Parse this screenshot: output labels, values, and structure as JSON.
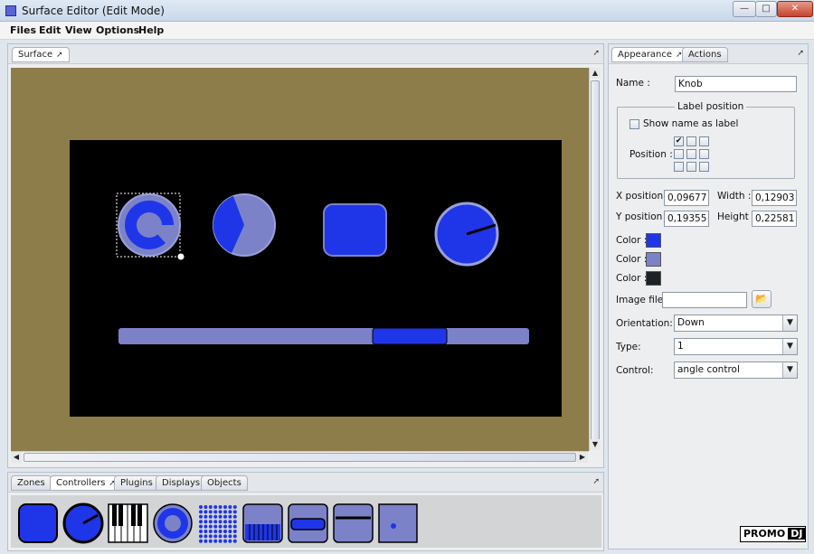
{
  "window": {
    "title": "Surface Editor (Edit Mode)"
  },
  "menu": [
    "Files",
    "Edit",
    "View",
    "Options",
    "Help"
  ],
  "surface_panel": {
    "tab_label": "Surface"
  },
  "bottom_panel": {
    "tabs": [
      "Zones",
      "Controllers",
      "Plugins",
      "Displays",
      "Objects"
    ],
    "active_tab": "Controllers"
  },
  "right_panel": {
    "tabs": [
      "Appearance",
      "Actions"
    ],
    "active_tab": "Appearance",
    "name_label": "Name :",
    "name_value": "Knob",
    "label_position": {
      "title": "Label position",
      "show_name_label": "Show name as label",
      "show_name_checked": false,
      "position_label": "Position :",
      "grid_checked": [
        true,
        false,
        false,
        false,
        false,
        false,
        false,
        false,
        false
      ]
    },
    "x_position_label": "X position :",
    "x_position_value": "0,09677",
    "width_label": "Width :",
    "width_value": "0,12903",
    "y_position_label": "Y position :",
    "y_position_value": "0,19355",
    "height_label": "Height :",
    "height_value": "0,22581",
    "colors": [
      {
        "label": "Color :",
        "value": "#1f36e8"
      },
      {
        "label": "Color :",
        "value": "#7c82c8"
      },
      {
        "label": "Color :",
        "value": "#1d2226"
      }
    ],
    "image_file_label": "Image file:",
    "image_file_value": "",
    "orientation_label": "Orientation:",
    "orientation_value": "Down",
    "type_label": "Type:",
    "type_value": "1",
    "control_label": "Control:",
    "control_value": "angle control"
  },
  "surface_colors": {
    "background": "#8c7d4b",
    "panel": "#000000",
    "primary": "#1f36e8",
    "secondary": "#7c82c8"
  },
  "palette_items": [
    "pad-icon",
    "knob-icon",
    "piano-keys-icon",
    "encoder-icon",
    "dot-matrix-icon",
    "drawbar-icon",
    "button-icon",
    "fader-icon",
    "xy-pad-icon"
  ],
  "watermark": "PROMO DJ"
}
